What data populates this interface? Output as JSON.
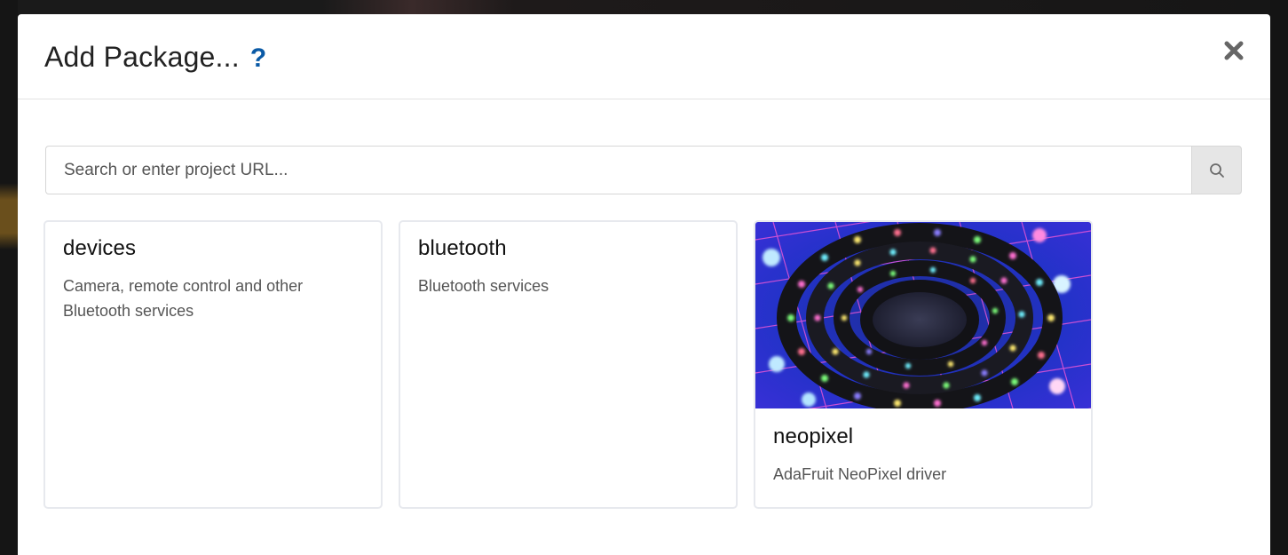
{
  "modal": {
    "title": "Add Package...",
    "help_label": "?",
    "close_icon": "close-icon",
    "close_label": "✖"
  },
  "search": {
    "placeholder": "Search or enter project URL...",
    "value": "",
    "icon": "search-icon"
  },
  "packages": [
    {
      "name": "devices",
      "description": "Camera, remote control and other Bluetooth services",
      "has_image": false
    },
    {
      "name": "bluetooth",
      "description": "Bluetooth services",
      "has_image": false
    },
    {
      "name": "neopixel",
      "description": "AdaFruit NeoPixel driver",
      "has_image": true,
      "image_subject": "neopixel-led-strip-image"
    }
  ],
  "colors": {
    "help_link": "#0a5aa6",
    "title_text": "#222222",
    "card_border": "#e7e9ee",
    "search_button_bg": "#e6e6e6"
  }
}
